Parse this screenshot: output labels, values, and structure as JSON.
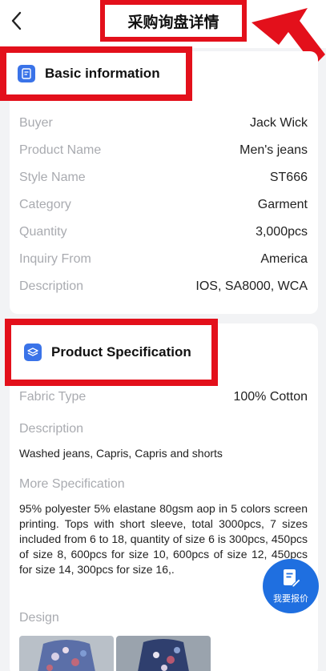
{
  "header": {
    "title": "采购询盘详情"
  },
  "basic": {
    "title": "Basic information",
    "rows": [
      {
        "label": "Buyer",
        "value": "Jack Wick"
      },
      {
        "label": "Product Name",
        "value": "Men's jeans"
      },
      {
        "label": "Style Name",
        "value": "ST666"
      },
      {
        "label": "Category",
        "value": "Garment"
      },
      {
        "label": "Quantity",
        "value": "3,000pcs"
      },
      {
        "label": "Inquiry From",
        "value": "America"
      },
      {
        "label": "Description",
        "value": "IOS, SA8000, WCA"
      }
    ]
  },
  "spec": {
    "title": "Product Specification",
    "fabric_label": "Fabric Type",
    "fabric_value": "100% Cotton",
    "description_label": "Description",
    "description_value": "Washed jeans, Capris, Capris and shorts",
    "more_label": "More Specification",
    "more_value": "95% polyester 5% elastane 80gsm aop in 5 colors screen printing. Tops with short sleeve, total 3000pcs, 7 sizes included from 6 to 18, quantity of size 6 is 300pcs, 450pcs of size 8, 600pcs for size 10, 600pcs of size 12, 450pcs for size 14, 300pcs for size 16,.",
    "design_label": "Design"
  },
  "fab": {
    "label": "我要报价"
  },
  "colors": {
    "accent": "#3a73e8",
    "highlight": "#e3101b",
    "fab": "#1f6fe0"
  }
}
